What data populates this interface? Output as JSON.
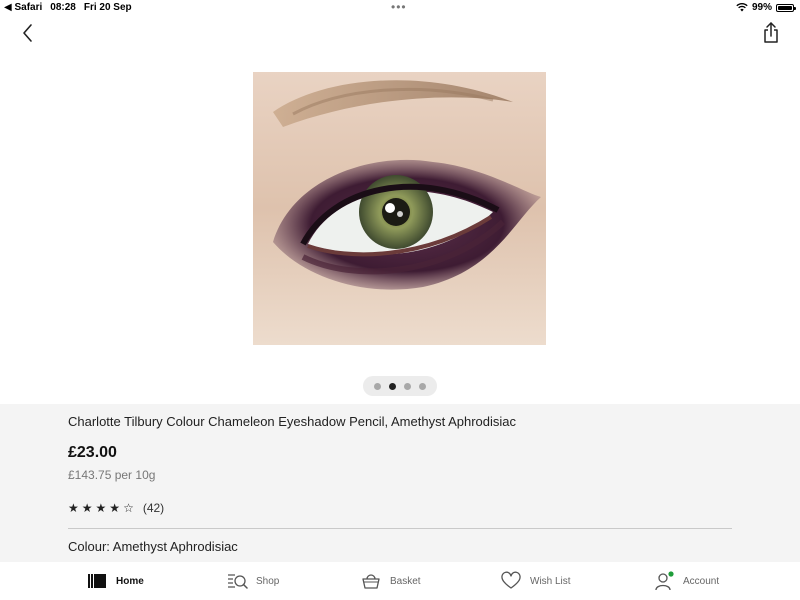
{
  "status_bar": {
    "back_app": "◀ Safari",
    "time": "08:28",
    "date": "Fri 20 Sep",
    "battery": "99%",
    "battery_level": 0.99
  },
  "carousel": {
    "dots": 4,
    "active_index": 1
  },
  "product": {
    "title": "Charlotte Tilbury Colour Chameleon Eyeshadow Pencil, Amethyst Aphrodisiac",
    "price": "£23.00",
    "unit_price": "£143.75 per 10g",
    "rating_stars": [
      "★",
      "★",
      "★",
      "★",
      "☆"
    ],
    "rating": 4,
    "review_count": "(42)",
    "colour": "Colour: Amethyst Aphrodisiac"
  },
  "tabbar": {
    "home": "Home",
    "shop": "Shop",
    "basket": "Basket",
    "wishlist": "Wish List",
    "account": "Account"
  },
  "colors": {
    "active_dot": "#222222",
    "account_badge": "#1f9d3a",
    "info_bg": "#f4f4f4"
  }
}
